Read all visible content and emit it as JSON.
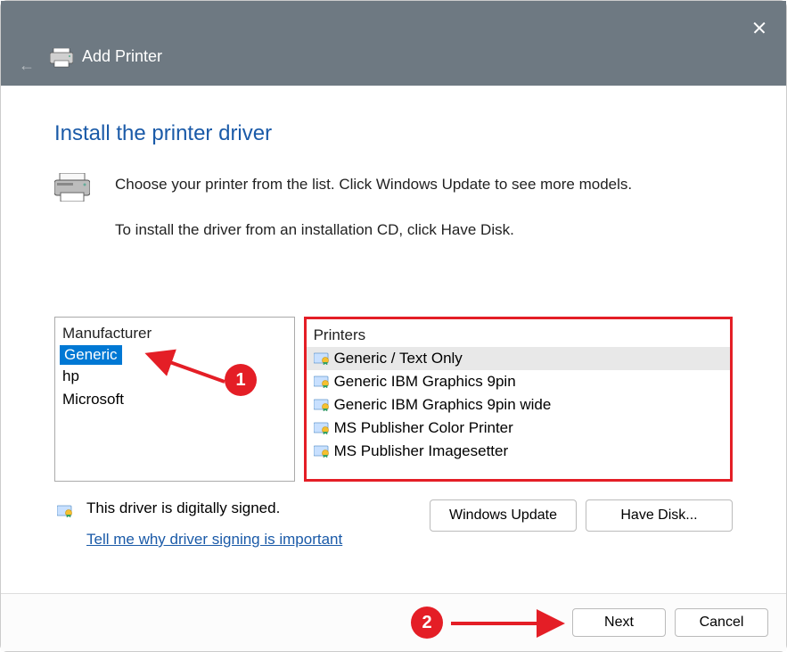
{
  "titlebar": {
    "title": "Add Printer"
  },
  "heading": "Install the printer driver",
  "intro": {
    "line1": "Choose your printer from the list. Click Windows Update to see more models.",
    "line2": "To install the driver from an installation CD, click Have Disk."
  },
  "manufacturer": {
    "header": "Manufacturer",
    "items": [
      "Generic",
      "hp",
      "Microsoft"
    ],
    "selected": 0
  },
  "printers": {
    "header": "Printers",
    "items": [
      "Generic / Text Only",
      "Generic IBM Graphics 9pin",
      "Generic IBM Graphics 9pin wide",
      "MS Publisher Color Printer",
      "MS Publisher Imagesetter"
    ],
    "selected": 0
  },
  "signed": {
    "text": "This driver is digitally signed.",
    "link": "Tell me why driver signing is important"
  },
  "buttons": {
    "windows_update": "Windows Update",
    "have_disk": "Have Disk...",
    "next": "Next",
    "cancel": "Cancel"
  },
  "annotations": {
    "step1": "1",
    "step2": "2"
  }
}
